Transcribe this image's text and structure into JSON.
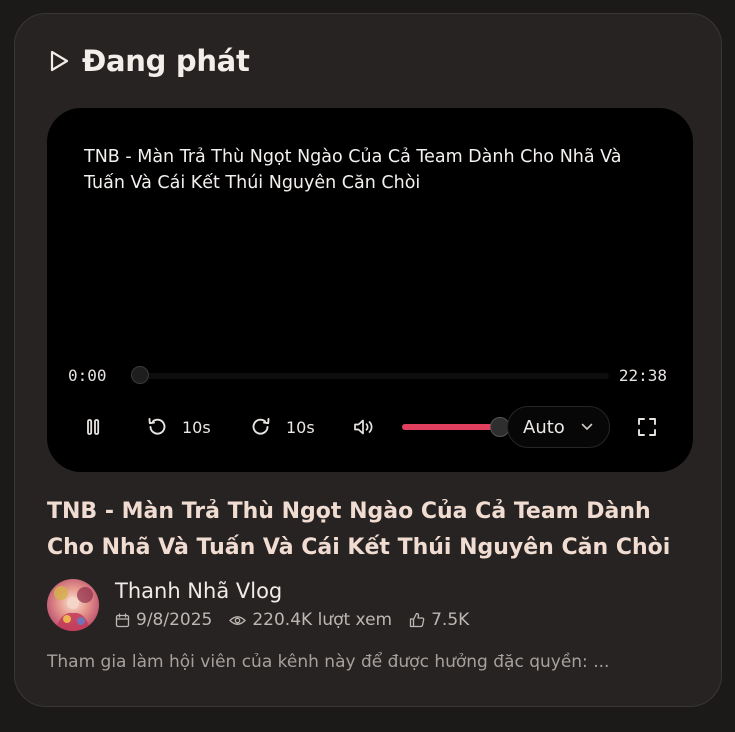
{
  "section": {
    "icon": "play-outline-icon",
    "title": "Đang phát"
  },
  "player": {
    "overlay_title": "TNB - Màn Trả Thù Ngọt Ngào Của Cả Team Dành Cho Nhã Và Tuấn Và Cái Kết Thúi Nguyên Căn Chòi",
    "current_time": "0:00",
    "duration": "22:38",
    "progress_fraction": 0.0,
    "volume_fraction": 1.0,
    "controls": {
      "pause_icon": "pause-icon",
      "rewind_icon": "rewind-10-icon",
      "rewind_label": "10s",
      "forward_icon": "forward-10-icon",
      "forward_label": "10s",
      "volume_icon": "volume-icon",
      "quality_label": "Auto",
      "quality_icon": "chevron-down-icon",
      "fullscreen_icon": "fullscreen-icon"
    },
    "accent_color": "#e0405e"
  },
  "video": {
    "title": "TNB - Màn Trả Thù Ngọt Ngào Của Cả Team Dành Cho Nhã Và Tuấn Và Cái Kết Thúi Nguyên Căn Chòi",
    "channel": "Thanh Nhã Vlog",
    "date": "9/8/2025",
    "views": "220.4K lượt xem",
    "likes": "7.5K",
    "description": "Tham gia làm hội viên của kênh này để được hưởng đặc quyền: ..."
  }
}
